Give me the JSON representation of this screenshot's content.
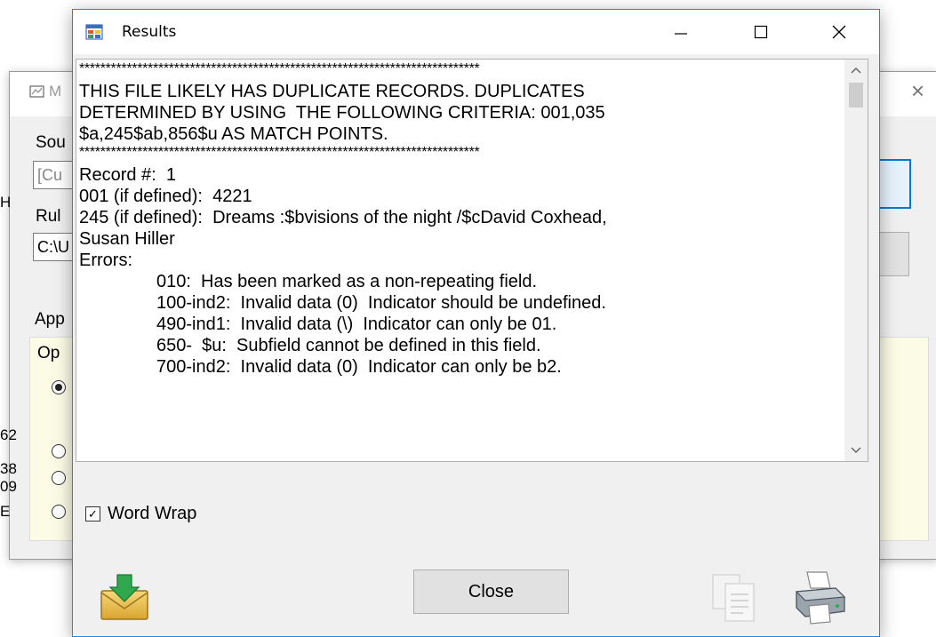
{
  "background_window": {
    "title": "M",
    "labels": {
      "source": "Sou",
      "rules": "Rul",
      "applies": "App",
      "options_group": "Op"
    },
    "fields": {
      "source_value": "[Cu",
      "rules_value": "C:\\U"
    },
    "edge_letters": [
      "H",
      "62",
      "38",
      "09",
      "E"
    ]
  },
  "results_window": {
    "title": "Results",
    "controls": {
      "minimize": "—",
      "maximize": "☐",
      "close": "✕"
    },
    "text_lines": [
      {
        "text": "****************************************************************************",
        "kind": "star"
      },
      {
        "text": "THIS FILE LIKELY HAS DUPLICATE RECORDS. DUPLICATES",
        "kind": "normal"
      },
      {
        "text": "DETERMINED BY USING  THE FOLLOWING CRITERIA: 001,035",
        "kind": "normal"
      },
      {
        "text": "$a,245$ab,856$u AS MATCH POINTS.",
        "kind": "normal"
      },
      {
        "text": "****************************************************************************",
        "kind": "star"
      },
      {
        "text": "Record #:  1",
        "kind": "normal"
      },
      {
        "text": "001 (if defined):  4221",
        "kind": "normal"
      },
      {
        "text": "245 (if defined):  Dreams :$bvisions of the night /$cDavid Coxhead,",
        "kind": "normal"
      },
      {
        "text": "Susan Hiller",
        "kind": "normal"
      },
      {
        "text": "Errors:",
        "kind": "normal"
      },
      {
        "text": "010:  Has been marked as a non-repeating field.",
        "kind": "err"
      },
      {
        "text": "100-ind2:  Invalid data (0)  Indicator should be undefined.",
        "kind": "err"
      },
      {
        "text": "490-ind1:  Invalid data (\\)  Indicator can only be 01.",
        "kind": "err"
      },
      {
        "text": "650-  $u:  Subfield cannot be defined in this field.",
        "kind": "err"
      },
      {
        "text": "700-ind2:  Invalid data (0)  Indicator can only be b2.",
        "kind": "err"
      }
    ],
    "scroll_up": "^",
    "scroll_down": "v",
    "word_wrap": {
      "label": "Word Wrap",
      "checked": true,
      "check_mark": "✓"
    },
    "close_button": "Close",
    "icons": [
      "export-icon",
      "copy-icon",
      "print-icon"
    ]
  }
}
